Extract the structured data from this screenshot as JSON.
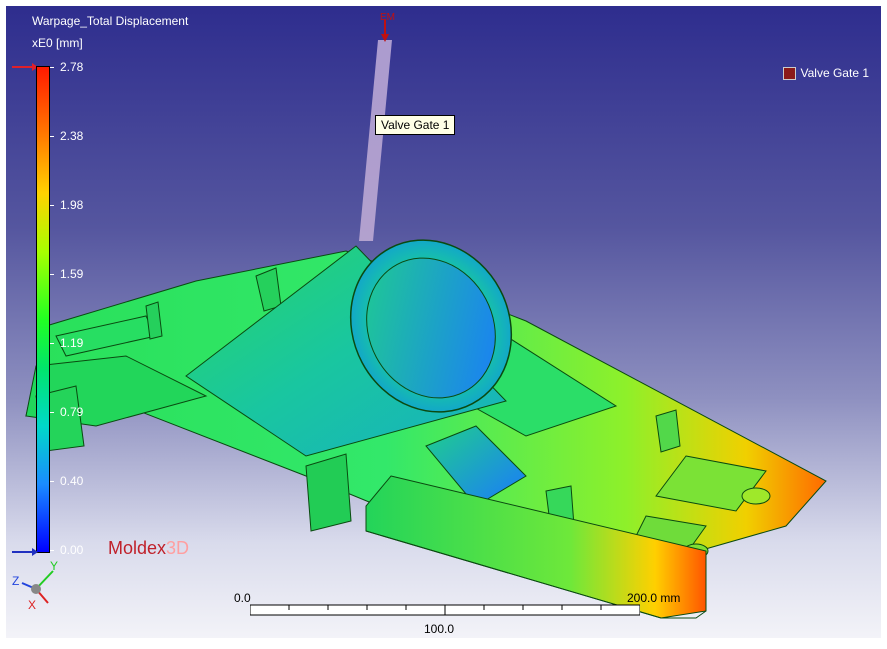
{
  "result": {
    "title": "Warpage_Total Displacement",
    "unit": "xE0 [mm]"
  },
  "colorbar": {
    "labels": [
      "2.78",
      "2.38",
      "1.98",
      "1.59",
      "1.19",
      "0.79",
      "0.40",
      "0.00"
    ],
    "max_marker_color": "#e0202a",
    "min_marker_color": "#2030c0"
  },
  "brand": {
    "main": "Moldex",
    "suffix": "3D"
  },
  "legend": {
    "label": "Valve Gate 1",
    "swatch_color": "#8b1a1a"
  },
  "tooltip": {
    "label": "Valve Gate 1"
  },
  "gate_marker": {
    "label": "EM"
  },
  "scale": {
    "start": "0.0",
    "middle": "100.0",
    "end": "200.0 mm"
  },
  "axes": {
    "x": "X",
    "y": "Y",
    "z": "Z"
  },
  "colors": {
    "background_top": "#2e2d8e",
    "background_bottom": "#f3f3f8"
  }
}
